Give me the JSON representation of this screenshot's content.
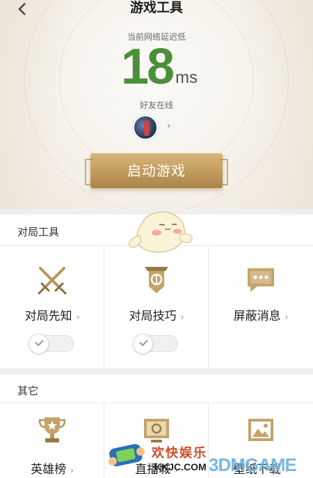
{
  "header": {
    "title": "游戏工具",
    "back_icon": "back-chevron-icon"
  },
  "status": {
    "network_label": "当前网络延迟低",
    "latency_value": "18",
    "latency_unit": "ms",
    "friends_label": "好友在线"
  },
  "start_button": {
    "label": "启动游戏"
  },
  "colors": {
    "latency": "#4a8f3a",
    "gold": "#c19a5b"
  },
  "match_tools": {
    "title": "对局工具",
    "items": [
      {
        "label": "对局先知",
        "icon": "crossed-swords-icon",
        "toggle_on": false
      },
      {
        "label": "对局技巧",
        "icon": "banner-shield-icon",
        "toggle_on": false
      },
      {
        "label": "屏蔽消息",
        "icon": "message-bubble-icon"
      }
    ]
  },
  "others": {
    "title": "其它",
    "items": [
      {
        "label": "英雄榜",
        "icon": "trophy-icon"
      },
      {
        "label": "直播城",
        "icon": "live-screen-icon"
      },
      {
        "label": "壁纸下载",
        "icon": "wallpaper-image-icon"
      }
    ]
  },
  "watermark": {
    "brand": "欢快娱乐",
    "site": "KKJC.COM",
    "logo_text": "3DMGAME"
  }
}
